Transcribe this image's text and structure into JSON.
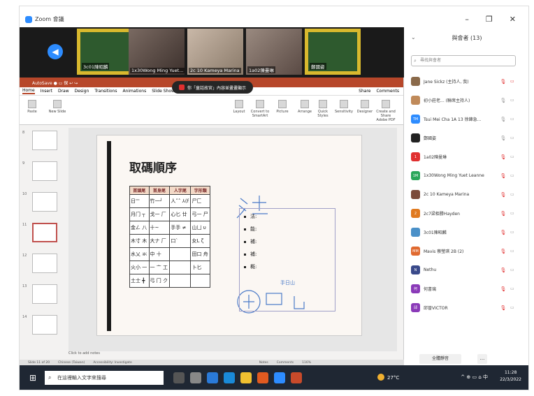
{
  "window": {
    "title": "Zoom 會議",
    "minimize": "–",
    "restore": "❐",
    "close": "✕"
  },
  "video_tiles": [
    {
      "name": "3c01陳昭麟",
      "style": "frameY"
    },
    {
      "name": "1x30Wong Ming Yuet...",
      "style": "face1"
    },
    {
      "name": "2c 10 Kameya Marina",
      "style": "face2"
    },
    {
      "name": "1a02陳曼琳",
      "style": "face3"
    },
    {
      "name": "鄭國姿",
      "style": "frameY"
    }
  ],
  "share_banner": "你「童話故宮」內容並畫畫顯示",
  "ppt": {
    "title_text": "AutoSave ● ▭ 保 ↩ ↪",
    "tabs": [
      "Home",
      "Insert",
      "Draw",
      "Design",
      "Transitions",
      "Animations",
      "Slide Show"
    ],
    "share_label": "Share",
    "comments_label": "Comments",
    "ribbon": [
      "Paste",
      "New Slide",
      "Layout",
      "Convert to SmartArt",
      "Picture",
      "Arrange",
      "Quick Styles",
      "Sensitivity",
      "Designer",
      "Create and Share Adobe PDF"
    ],
    "slide_numbers": [
      "8",
      "9",
      "10",
      "11",
      "12",
      "13",
      "14"
    ],
    "notes_label": "Click to add notes",
    "status_left": "Slide 11 of 20",
    "status_mid": "Chinese (Taiwan)",
    "status_acc": "Accessibility: Investigate",
    "status_notes": "Notes",
    "status_comments": "Comments",
    "zoom": "116%"
  },
  "slide": {
    "heading": "取碼順序",
    "table_headers": [
      "首頭尾",
      "首身尾",
      "人字尾",
      "字形類"
    ],
    "table_rows": [
      [
        "日'''",
        "竹一╯",
        "人˄˄ ⅄(f",
        "尸匚"
      ],
      [
        "月门 ┬",
        "戈一 厂",
        "心匕 廿",
        "弓一 尸"
      ],
      [
        "金ㄥ 八",
        "十~",
        "手手 ≠",
        "山凵 υ"
      ],
      [
        "木寸 木",
        "大ナ 厂",
        "口`",
        "女L ζ"
      ],
      [
        "水乂 氺",
        "中 十",
        "",
        "田口 舟"
      ],
      [
        "火小 一",
        "一 亠 工",
        "",
        "卜匕"
      ],
      [
        "土士 ╋",
        "弓 冂 ク",
        "",
        ""
      ]
    ],
    "bullets": [
      "法:",
      "能:",
      "補:",
      "補:",
      "概:"
    ],
    "hand_note": "手日山"
  },
  "participants": {
    "title": "與會者 (13)",
    "search_placeholder": "尋找與會者",
    "list": [
      {
        "name": "Jane Sickz (主持人, 我)",
        "color": "#8a6a4a",
        "initial": "",
        "mic": "muted",
        "cam": "muted"
      },
      {
        "name": "初小莊老... (聯席主持人)",
        "color": "#c08a5a",
        "initial": "",
        "mic": "on",
        "cam": "on"
      },
      {
        "name": "Tsui Mei Cha 1A 13 徐鋒急...",
        "color": "#2D8CFF",
        "initial": "TM",
        "mic": "on",
        "cam": "on"
      },
      {
        "name": "鄭國姿",
        "color": "#222",
        "initial": "",
        "mic": "on",
        "cam": "on"
      },
      {
        "name": "1a02陳曼琳",
        "color": "#e02f2f",
        "initial": "1",
        "mic": "muted",
        "cam": "on"
      },
      {
        "name": "1x30Wong Ming Yuet Leanne",
        "color": "#2aa65a",
        "initial": "1M",
        "mic": "muted",
        "cam": "on"
      },
      {
        "name": "2c 10 Kameya Marina",
        "color": "#7a4a3a",
        "initial": "",
        "mic": "muted",
        "cam": "on"
      },
      {
        "name": "2c7梁栢勝Hayden",
        "color": "#e07a20",
        "initial": "2",
        "mic": "muted",
        "cam": "on"
      },
      {
        "name": "3c01陳昭麟",
        "color": "#4a90c8",
        "initial": "",
        "mic": "muted",
        "cam": "on"
      },
      {
        "name": "Mavis 蔡瑩琪 2B (2)",
        "color": "#e06a30",
        "initial": "MM",
        "mic": "muted",
        "cam": "on"
      },
      {
        "name": "Nethu",
        "color": "#3a4a8a",
        "initial": "N",
        "mic": "muted",
        "cam": "on"
      },
      {
        "name": "何書璃",
        "color": "#8a3ab8",
        "initial": "何",
        "mic": "muted",
        "cam": "on"
      },
      {
        "name": "邱晉VICTOR",
        "color": "#8a3ab8",
        "initial": "邱",
        "mic": "muted",
        "cam": "on"
      }
    ],
    "mute_all": "全體靜音",
    "more": "..."
  },
  "taskbar": {
    "search_placeholder": "在這裡輸入文字來搜尋",
    "weather": "27°C",
    "tray": "^ ⊕ ▭ ⌂ 中",
    "time": "11:28",
    "date": "22/3/2022"
  },
  "colors": {
    "zoom_blue": "#2D8CFF",
    "ppt_red": "#b7472a",
    "muted_red": "#e02f2f",
    "taskbar": "#1f2733"
  }
}
